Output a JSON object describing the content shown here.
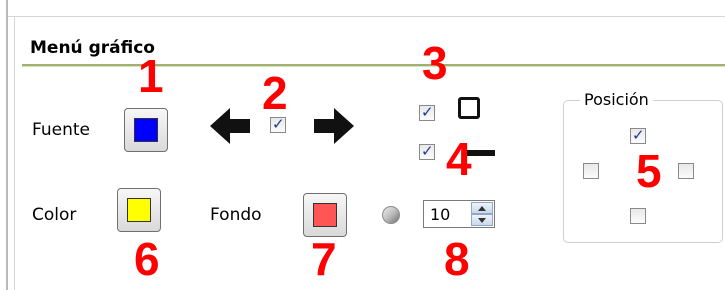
{
  "panel": {
    "title": "Menú gráfico"
  },
  "labels": {
    "fuente": "Fuente",
    "color": "Color",
    "fondo": "Fondo"
  },
  "colors": {
    "fuente": "#0000ff",
    "color": "#ffff00",
    "fondo": "#ff5555"
  },
  "checkboxes": {
    "arrows_center": true,
    "frame": true,
    "line": true,
    "pos_top": true,
    "pos_left": false,
    "pos_right": false,
    "pos_bottom": false
  },
  "spinner": {
    "value": "10"
  },
  "group": {
    "label": "Posición"
  },
  "annotations": [
    "1",
    "2",
    "3",
    "4",
    "5",
    "6",
    "7",
    "8"
  ]
}
